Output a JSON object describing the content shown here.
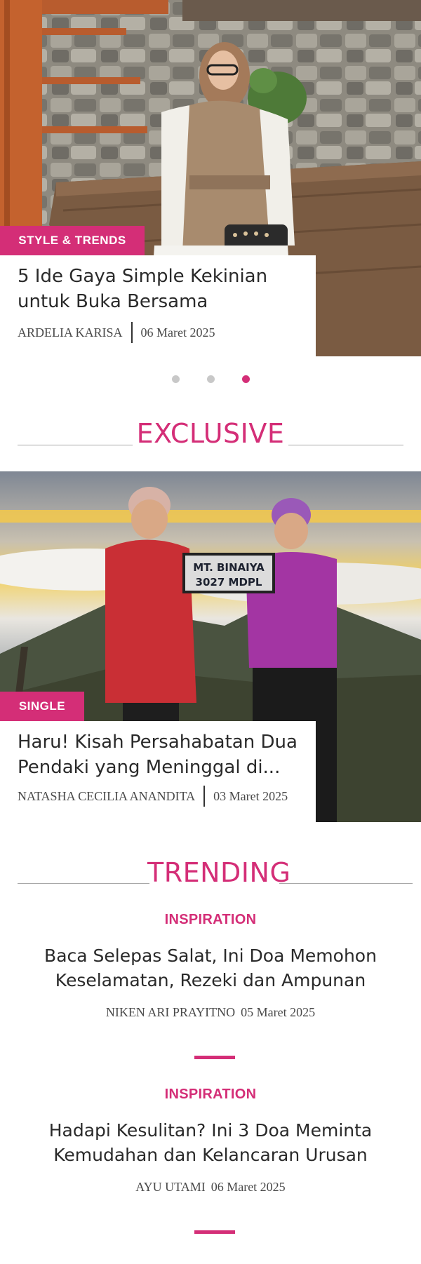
{
  "slider": {
    "category": "STYLE & TRENDS",
    "title": "5 Ide Gaya Simple Kekinian untuk Buka Bersama",
    "author": "ARDELIA KARISA",
    "date": "06 Maret 2025",
    "total_slides": 3,
    "active_slide": 3
  },
  "exclusive": {
    "heading": "EXCLUSIVE",
    "category": "SINGLE",
    "title": "Haru! Kisah Persahabatan Dua Pendaki yang Meninggal di...",
    "author": "NATASHA CECILIA ANANDITA",
    "date": "03 Maret 2025",
    "sign_line1": "MT. BINAIYA",
    "sign_line2": "3027 MDPL"
  },
  "trending": {
    "heading": "TRENDING",
    "items": [
      {
        "category": "INSPIRATION",
        "title": "Baca Selepas Salat, Ini Doa Memohon Keselamatan, Rezeki dan Ampunan",
        "author": "NIKEN ARI PRAYITNO",
        "date": "05 Maret 2025"
      },
      {
        "category": "INSPIRATION",
        "title": "Hadapi Kesulitan? Ini 3 Doa Meminta Kemudahan dan Kelancaran Urusan",
        "author": "AYU UTAMI",
        "date": "06 Maret 2025"
      }
    ]
  },
  "colors": {
    "accent": "#d42e77",
    "text": "#2a2a2a",
    "divider": "#a8a8a8"
  }
}
